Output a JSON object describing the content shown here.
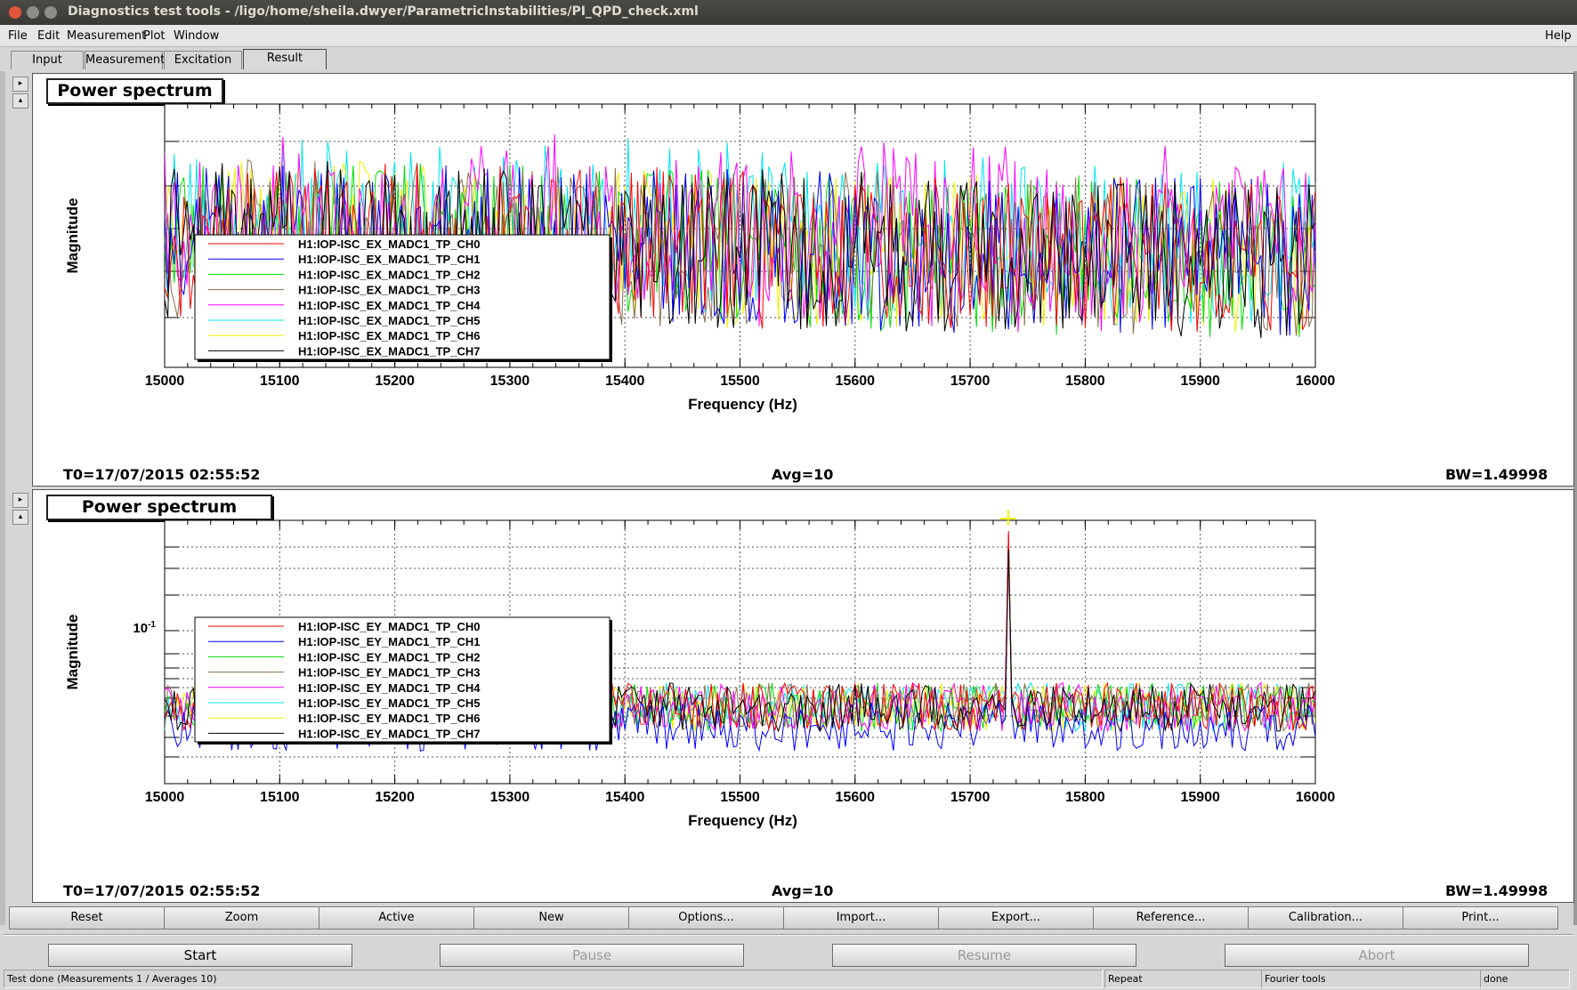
{
  "window": {
    "title": "Diagnostics test tools - /ligo/home/sheila.dwyer/ParametricInstabilities/PI_QPD_check.xml"
  },
  "menu": {
    "file": "File",
    "edit": "Edit",
    "measurement": "Measurement",
    "plot": "Plot",
    "window": "Window",
    "help": "Help"
  },
  "tabs": [
    "Input",
    "Measurement",
    "Excitation",
    "Result"
  ],
  "active_tab": "Result",
  "panels": [
    {
      "title": "Power spectrum",
      "t0": "T0=17/07/2015 02:55:52",
      "avg": "Avg=10",
      "bw": "BW=1.49998",
      "y_tick_label": "",
      "legend": [
        "H1:IOP-ISC_EX_MADC1_TP_CH0",
        "H1:IOP-ISC_EX_MADC1_TP_CH1",
        "H1:IOP-ISC_EX_MADC1_TP_CH2",
        "H1:IOP-ISC_EX_MADC1_TP_CH3",
        "H1:IOP-ISC_EX_MADC1_TP_CH4",
        "H1:IOP-ISC_EX_MADC1_TP_CH5",
        "H1:IOP-ISC_EX_MADC1_TP_CH6",
        "H1:IOP-ISC_EX_MADC1_TP_CH7"
      ]
    },
    {
      "title": "Power spectrum",
      "t0": "T0=17/07/2015 02:55:52",
      "avg": "Avg=10",
      "bw": "BW=1.49998",
      "y_tick_label": "10-1",
      "legend": [
        "H1:IOP-ISC_EY_MADC1_TP_CH0",
        "H1:IOP-ISC_EY_MADC1_TP_CH1",
        "H1:IOP-ISC_EY_MADC1_TP_CH2",
        "H1:IOP-ISC_EY_MADC1_TP_CH3",
        "H1:IOP-ISC_EY_MADC1_TP_CH4",
        "H1:IOP-ISC_EY_MADC1_TP_CH5",
        "H1:IOP-ISC_EY_MADC1_TP_CH6",
        "H1:IOP-ISC_EY_MADC1_TP_CH7"
      ]
    }
  ],
  "series_colors": [
    "#ff0000",
    "#0000ff",
    "#00dd00",
    "#8b6f4e",
    "#ff00ff",
    "#00e5ee",
    "#f0f000",
    "#000000"
  ],
  "chart_data": [
    {
      "type": "line",
      "title": "Power spectrum",
      "xlabel": "Frequency (Hz)",
      "ylabel": "Magnitude",
      "xlim": [
        15000,
        16000
      ],
      "x_ticks": [
        "15000",
        "15100",
        "15200",
        "15300",
        "15400",
        "15500",
        "15600",
        "15700",
        "15800",
        "15900",
        "16000"
      ],
      "y_scale": "log",
      "grid": true,
      "legend_position": "bottom-left",
      "series": [
        {
          "name": "H1:IOP-ISC_EX_MADC1_TP_CH0"
        },
        {
          "name": "H1:IOP-ISC_EX_MADC1_TP_CH1"
        },
        {
          "name": "H1:IOP-ISC_EX_MADC1_TP_CH2"
        },
        {
          "name": "H1:IOP-ISC_EX_MADC1_TP_CH3"
        },
        {
          "name": "H1:IOP-ISC_EX_MADC1_TP_CH4"
        },
        {
          "name": "H1:IOP-ISC_EX_MADC1_TP_CH5"
        },
        {
          "name": "H1:IOP-ISC_EX_MADC1_TP_CH6"
        },
        {
          "name": "H1:IOP-ISC_EX_MADC1_TP_CH7"
        }
      ]
    },
    {
      "type": "line",
      "title": "Power spectrum",
      "xlabel": "Frequency (Hz)",
      "ylabel": "Magnitude",
      "xlim": [
        15000,
        16000
      ],
      "x_ticks": [
        "15000",
        "15100",
        "15200",
        "15300",
        "15400",
        "15500",
        "15600",
        "15700",
        "15800",
        "15900",
        "16000"
      ],
      "y_scale": "log",
      "grid": true,
      "legend_position": "bottom-left",
      "peak_frequency": 15733,
      "series": [
        {
          "name": "H1:IOP-ISC_EY_MADC1_TP_CH0"
        },
        {
          "name": "H1:IOP-ISC_EY_MADC1_TP_CH1"
        },
        {
          "name": "H1:IOP-ISC_EY_MADC1_TP_CH2"
        },
        {
          "name": "H1:IOP-ISC_EY_MADC1_TP_CH3"
        },
        {
          "name": "H1:IOP-ISC_EY_MADC1_TP_CH4"
        },
        {
          "name": "H1:IOP-ISC_EY_MADC1_TP_CH5"
        },
        {
          "name": "H1:IOP-ISC_EY_MADC1_TP_CH6"
        },
        {
          "name": "H1:IOP-ISC_EY_MADC1_TP_CH7"
        }
      ]
    }
  ],
  "toolbar": [
    "Reset",
    "Zoom",
    "Active",
    "New",
    "Options...",
    "Import...",
    "Export...",
    "Reference...",
    "Calibration...",
    "Print..."
  ],
  "controls": {
    "start": "Start",
    "pause": "Pause",
    "resume": "Resume",
    "abort": "Abort"
  },
  "status": {
    "message": "Test done (Measurements 1 / Averages 10)",
    "repeat": "Repeat",
    "tools": "Fourier tools",
    "state": "done"
  }
}
